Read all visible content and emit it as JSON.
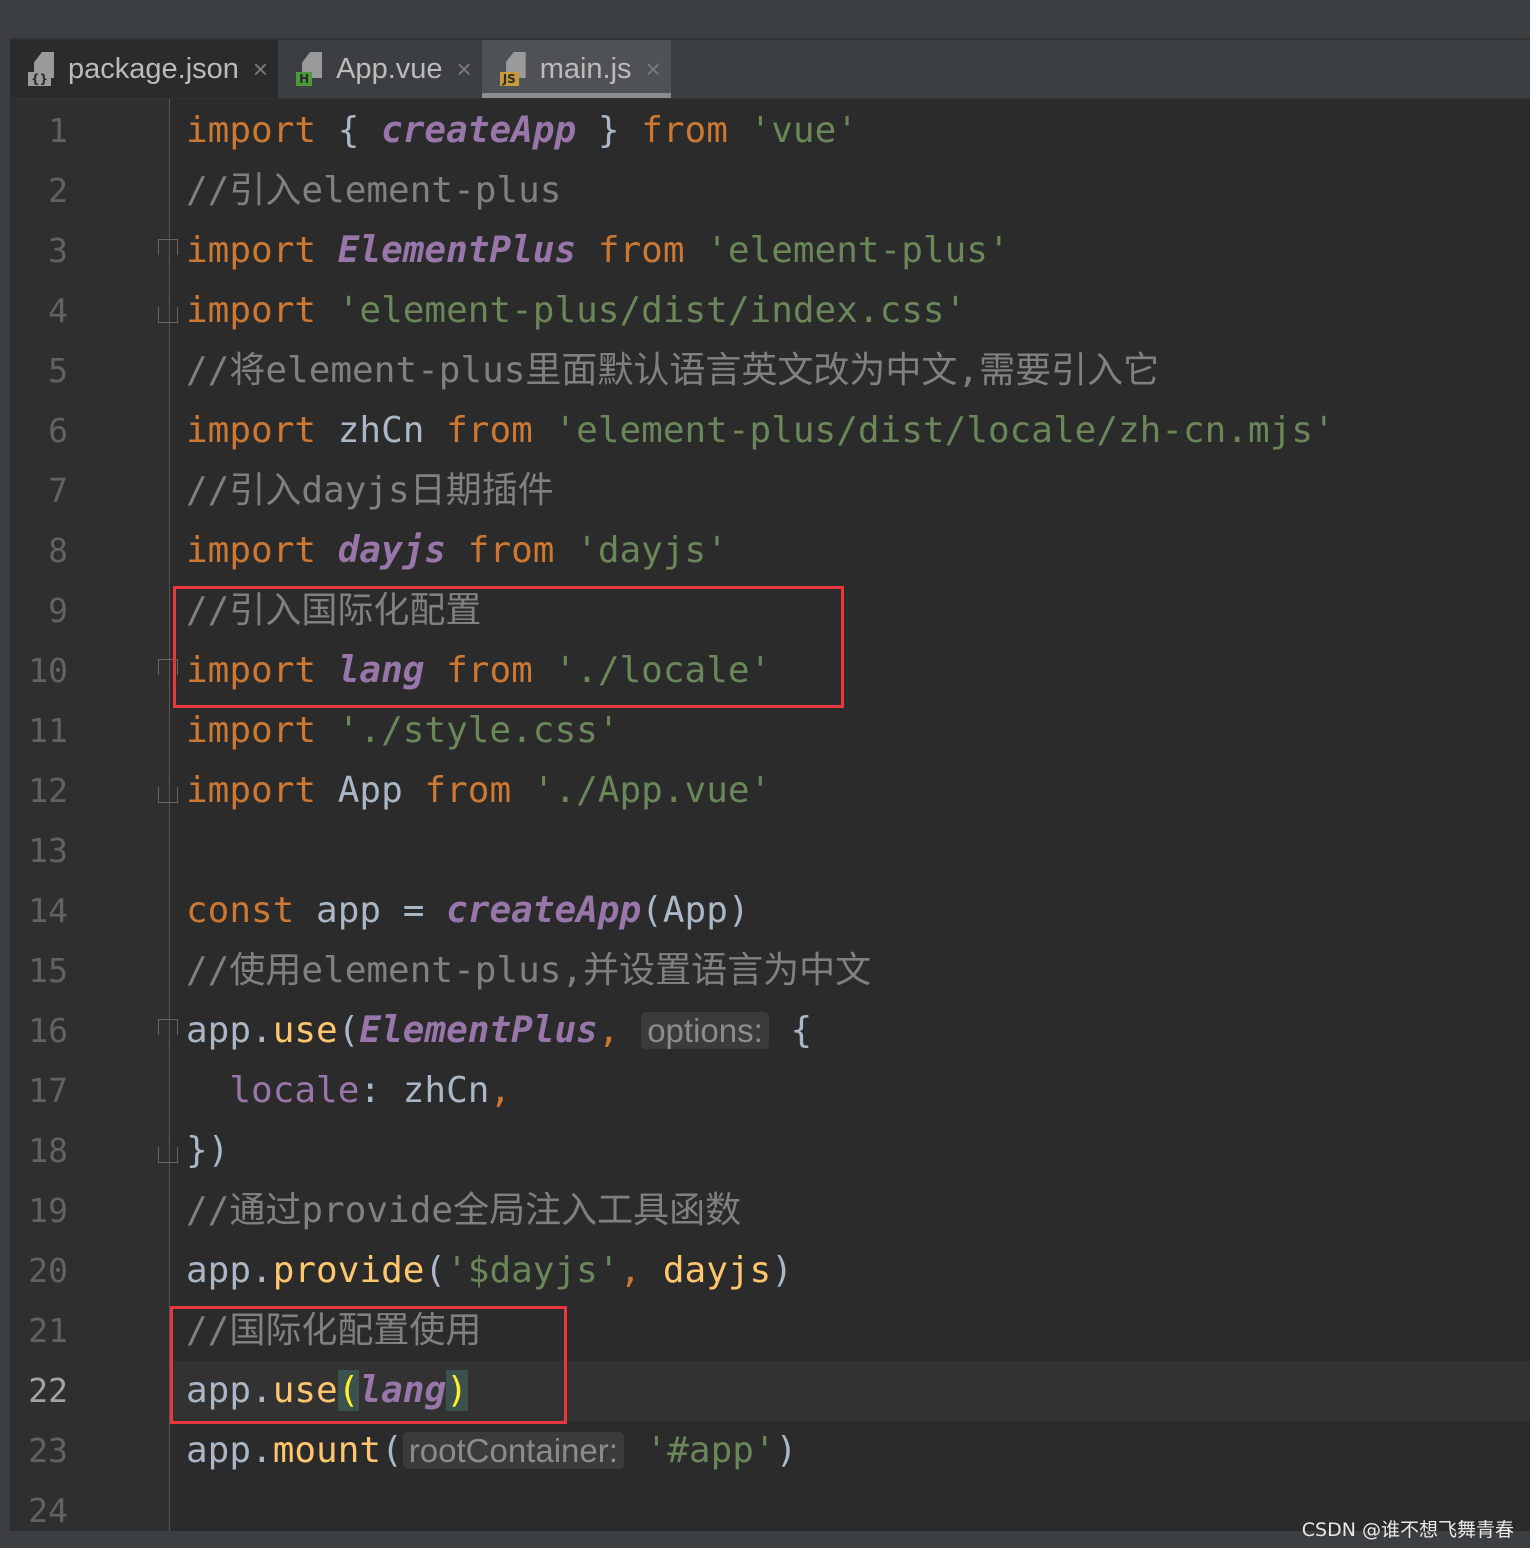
{
  "tabs": [
    {
      "label": "package.json",
      "icon": "json-file-icon",
      "badge": "{}",
      "badge_color": "#9a9a9a",
      "active": false
    },
    {
      "label": "App.vue",
      "icon": "vue-file-icon",
      "badge": "H",
      "badge_color": "#4b9b3a",
      "active": false
    },
    {
      "label": "main.js",
      "icon": "js-file-icon",
      "badge": "JS",
      "badge_color": "#c99a3c",
      "active": true
    }
  ],
  "current_line": 22,
  "colors": {
    "keyword": "#cc7832",
    "identifier_purple": "#9876aa",
    "string": "#6a8759",
    "comment": "#808080",
    "default": "#a9b7c6",
    "function": "#ffc66d",
    "highlight_box": "#e8383d"
  },
  "code": [
    [
      [
        "kw",
        "import "
      ],
      [
        "pl",
        "{ "
      ],
      [
        "it",
        "createApp"
      ],
      [
        "pl",
        " } "
      ],
      [
        "kw",
        "from "
      ],
      [
        "st",
        "'vue'"
      ]
    ],
    [
      [
        "cm",
        "//引入element-plus"
      ]
    ],
    [
      [
        "kw",
        "import "
      ],
      [
        "it",
        "ElementPlus"
      ],
      [
        "kw",
        " from "
      ],
      [
        "st",
        "'element-plus'"
      ]
    ],
    [
      [
        "kw",
        "import "
      ],
      [
        "st",
        "'element-plus/dist/index.css'"
      ]
    ],
    [
      [
        "cm",
        "//将element-plus里面默认语言英文改为中文,需要引入它"
      ]
    ],
    [
      [
        "kw",
        "import "
      ],
      [
        "pl",
        "zhCn "
      ],
      [
        "kw",
        "from "
      ],
      [
        "st",
        "'element-plus/dist/locale/zh-cn.mjs'"
      ]
    ],
    [
      [
        "cm",
        "//引入dayjs日期插件"
      ]
    ],
    [
      [
        "kw",
        "import "
      ],
      [
        "it",
        "dayjs"
      ],
      [
        "kw",
        " from "
      ],
      [
        "st",
        "'dayjs'"
      ]
    ],
    [
      [
        "cm",
        "//引入国际化配置"
      ]
    ],
    [
      [
        "kw",
        "import "
      ],
      [
        "it",
        "lang"
      ],
      [
        "kw",
        " from "
      ],
      [
        "st",
        "'./locale'"
      ]
    ],
    [
      [
        "kw",
        "import "
      ],
      [
        "st",
        "'./style.css'"
      ]
    ],
    [
      [
        "kw",
        "import "
      ],
      [
        "pl",
        "App "
      ],
      [
        "kw",
        "from "
      ],
      [
        "st",
        "'./App.vue'"
      ]
    ],
    [],
    [
      [
        "kw",
        "const "
      ],
      [
        "pl",
        "app = "
      ],
      [
        "it",
        "createApp"
      ],
      [
        "pl",
        "(App)"
      ]
    ],
    [
      [
        "cm",
        "//使用element-plus,并设置语言为中文"
      ]
    ],
    [
      [
        "pl",
        "app."
      ],
      [
        "fn",
        "use"
      ],
      [
        "pl",
        "("
      ],
      [
        "it",
        "ElementPlus"
      ],
      [
        "kw",
        ", "
      ],
      [
        "hint",
        "options:"
      ],
      [
        "pl",
        " {"
      ]
    ],
    [
      [
        "pl",
        "  "
      ],
      [
        "pu",
        "locale"
      ],
      [
        "pl",
        ": zhCn"
      ],
      [
        "kw",
        ","
      ]
    ],
    [
      [
        "pl",
        "})"
      ]
    ],
    [
      [
        "cm",
        "//通过provide全局注入工具函数"
      ]
    ],
    [
      [
        "pl",
        "app."
      ],
      [
        "fn",
        "provide"
      ],
      [
        "pl",
        "("
      ],
      [
        "st",
        "'$dayjs'"
      ],
      [
        "kw",
        ", "
      ],
      [
        "fn",
        "dayjs"
      ],
      [
        "pl",
        ")"
      ]
    ],
    [
      [
        "cm",
        "//国际化配置使用"
      ]
    ],
    [
      [
        "pl",
        "app."
      ],
      [
        "fn",
        "use"
      ],
      [
        "br",
        "("
      ],
      [
        "it",
        "lang"
      ],
      [
        "br",
        ")"
      ]
    ],
    [
      [
        "pl",
        "app."
      ],
      [
        "fn",
        "mount"
      ],
      [
        "pl",
        "("
      ],
      [
        "hint",
        "rootContainer:"
      ],
      [
        "st",
        " '#app'"
      ],
      [
        "pl",
        ")"
      ]
    ],
    []
  ],
  "watermark": "CSDN @谁不想飞舞青春"
}
